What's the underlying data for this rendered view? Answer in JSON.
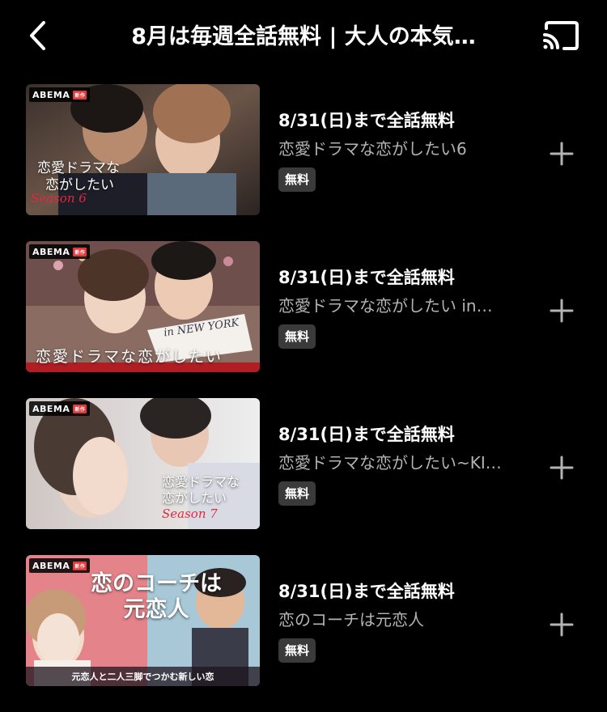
{
  "header": {
    "title": "8月は毎週全話無料 | 大人の本気…",
    "back_icon": "chevron-left-icon",
    "cast_icon": "cast-icon"
  },
  "items": [
    {
      "availability": "8/31(日)まで全話無料",
      "series": "恋愛ドラマな恋がしたい6",
      "badge": "無料",
      "logo": "ABEMA",
      "overlay_line1": "恋愛ドラマな",
      "overlay_line2": "恋がしたい",
      "overlay_season": "Season 6"
    },
    {
      "availability": "8/31(日)まで全話無料",
      "series": "恋愛ドラマな恋がしたい in…",
      "badge": "無料",
      "logo": "ABEMA",
      "overlay_line1": "恋愛ドラマな恋がしたい",
      "overlay_line2": "in NEW YORK",
      "overlay_season": ""
    },
    {
      "availability": "8/31(日)まで全話無料",
      "series": "恋愛ドラマな恋がしたい~KI…",
      "badge": "無料",
      "logo": "ABEMA",
      "overlay_line1": "恋愛ドラマな",
      "overlay_line2": "恋がしたい",
      "overlay_season": "Season 7"
    },
    {
      "availability": "8/31(日)まで全話無料",
      "series": "恋のコーチは元恋人",
      "badge": "無料",
      "logo": "ABEMA",
      "overlay_line1": "恋のコーチは",
      "overlay_line2": "元恋人",
      "overlay_season": "元恋人と二人三脚でつかむ新しい恋"
    }
  ],
  "colors": {
    "background": "#000000",
    "secondary_text": "#b3b3b3",
    "badge_bg": "#3a3a3a",
    "season_red": "#c2182a"
  }
}
